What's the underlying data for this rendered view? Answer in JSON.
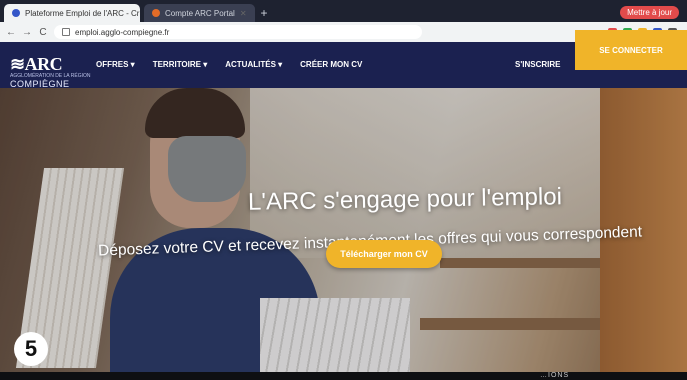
{
  "browser": {
    "tabs": [
      {
        "label": "Plateforme Emploi de l'ARC - Cr"
      },
      {
        "label": "Compte ARC Portal"
      }
    ],
    "profile_badge": "Mettre à jour",
    "url": "emploi.agglo-compiegne.fr"
  },
  "site": {
    "logo": {
      "mark": "≋ARC",
      "sub": "AGGLOMÉRATION DE LA RÉGION",
      "city": "COMPIÈGNE"
    },
    "menu": [
      "OFFRES ▾",
      "TERRITOIRE ▾",
      "ACTUALITÉS ▾",
      "CRÉER MON CV"
    ],
    "signup": "S'INSCRIRE",
    "connect": "SE CONNECTER"
  },
  "hero": {
    "title": "L'ARC s'engage pour l'emploi",
    "subtitle": "Déposez votre CV et recevez instantanément les offres qui vous correspondent",
    "cta": "Télécharger mon CV"
  },
  "overlay": {
    "badge": "5",
    "bottom_text": "…IONS"
  },
  "colors": {
    "navy": "#1b2150",
    "accent": "#f0b429"
  }
}
